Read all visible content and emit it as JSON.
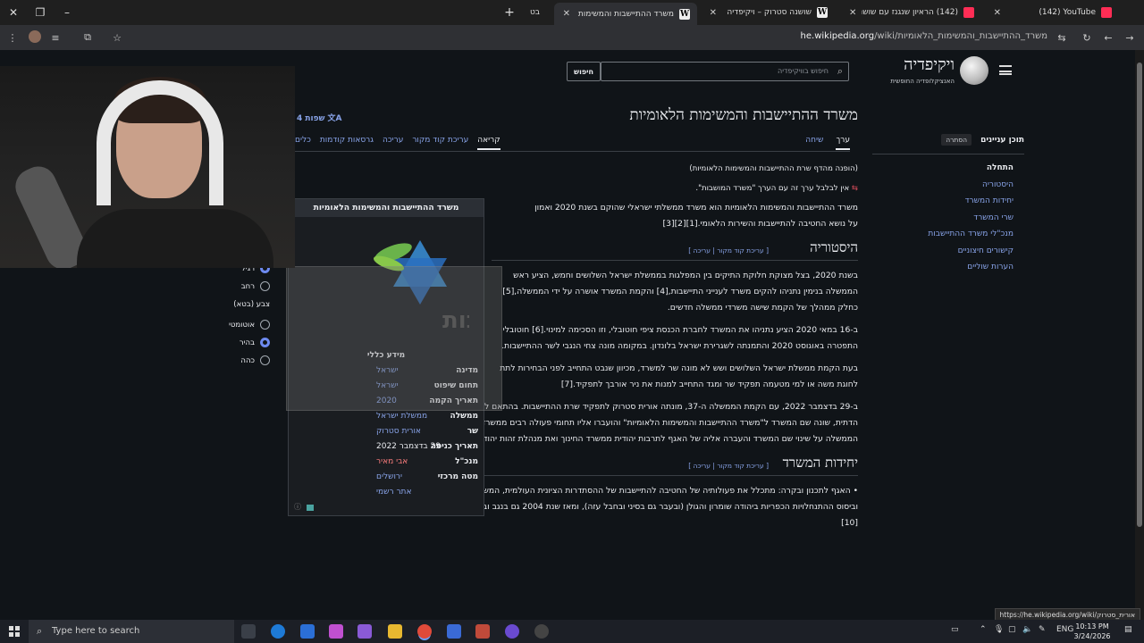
{
  "browser": {
    "tabs": [
      {
        "title": "(142) YouTube",
        "icon": "youtube-icon"
      },
      {
        "title": "(142) הראיון שנגנז עם שושנה ס",
        "icon": "youtube-icon"
      },
      {
        "title": "שושנה סטרוק – ויקיפדיה",
        "icon": "wikipedia-icon"
      },
      {
        "title": "משרד ההתיישבות והמשימות ה",
        "icon": "wikipedia-icon",
        "active": true
      },
      {
        "title": "בט",
        "icon": "page-icon"
      }
    ],
    "url_host": "he.wikipedia.org",
    "url_path": "/wiki/משרד_ההתיישבות_והמשימות_הלאומיות",
    "status_url": "https://he.wikipedia.org/wiki/אורית_סטרוק"
  },
  "wiki": {
    "logo_name": "ויקיפדיה",
    "logo_sub": "האנציקלופדיה החופשית",
    "search_placeholder": "חיפוש בוויקיפדיה",
    "search_button": "חיפוש",
    "toc_title": "תוכן עניינים",
    "toc_hide": "הסתרה",
    "toc_items": [
      "התחלה",
      "היסטוריה",
      "יחידות המשרד",
      "שרי המשרד",
      "מנכ\"לי משרד ההתיישבות",
      "קישורים חיצוניים",
      "הערות שוליים"
    ],
    "title": "משרד ההתיישבות והמשימות הלאומיות",
    "languages": "4 שפות",
    "tabs_right": [
      "ערך",
      "שיחה"
    ],
    "tabs_left": [
      "קריאה",
      "עריכת קוד מקור",
      "עריכה",
      "גרסאות קודמות",
      "כלים"
    ],
    "redirect_note": "(הופנה מהדף שרת ההתיישבות והמשימות הלאומיות)",
    "hatnote": "אין לבלבל ערך זה עם הערך \"משרד המושבות\".",
    "intro_line1": "משרד ההתיישבות והמשימות הלאומיות הוא משרד ממשלתי ישראלי שהוקם בשנת 2020 ואמון",
    "intro_line2": "על נושא החטיבה להתיישבות והשירות הלאומי.[1][2][3]",
    "section_history": "היסטוריה",
    "section_edit": "[ עריכת קוד מקור | עריכה ]",
    "p1": "בשנת 2020, בצל מצוקת חלוקת התיקים בין המפלגות בממשלת ישראל השלושים וחמש, הציע ראש הממשלה בנימין נתניהו להקים משרד לענייני התיישבות,[4] והקמת המשרד אושרה על ידי הממשלה,[5] כחלק ממהלך של הקמת שישה משרדי ממשלה חדשים.",
    "p2": "ב-16 במאי 2020 הציע נתניהו את המשרד לחברת הכנסת ציפי חוטובלי, וזו הסכימה למינוי.[6] חוטובלי התפטרה באוגוסט 2020 והתמנתה לשגרירת ישראל בלונדון. במקומה מונה צחי הנגבי לשר ההתיישבות.",
    "p3": "בעת הקמת ממשלת ישראל השלושים ושש לא מונה שר למשרד, מכיוון שנבט התחייב לפני הבחירות לתת לחוגת משה או למי מטעמה תפקיד שר ומגד התחייב למנות את ניר אורבך לתפקיד.[7]",
    "p4": "ב-29 בדצמבר 2022, עם הקמת הממשלה ה-37, מונתה אורית סטרוק לתפקיד שרת ההתיישבות. בהתאם להסכם הקואליציוני שנחתם בין סיעות הליכוד והציונות הדתית, שונה שם המשרד ל\"משרד ההתיישבות והמשימות הלאומיות\" והועברו אליו תחומי פעולה רבים ממשרדים אחרים.[8] ב-19 בפברואר 2023 החליטה הממשלה על שינוי שם המשרד והעברה אליה של האגף לתרבות יהודית ממשרד החינוך ואת מנהלת זהות יהודית מהמשרד לשירותי דת.[9]",
    "section_units": "יחידות המשרד",
    "p5": "האגף לתכנון ובקרה: מתכלל את פעולותיה של החטיבה להתיישבות של ההסתדרות הציונית העולמית, המשמשת כזרוע המבצעת של ממשלת ישראל בהקמת וביסוס ההתנחלויות הכפריות ביהודה שומרון והגולן (ובעבר גם בסיני ובחבל עזה), ומאז שנת 2004 גם בנגב ובגליל. עד 2020 היה האגף אגף במשרד החקלאות.[10]",
    "infobox": {
      "title": "משרד ההתיישבות והמשימות הלאומיות",
      "logo_text": "משרד ההתיישבות",
      "general": "מידע כללי",
      "rows": [
        {
          "label": "מדינה",
          "value": "ישראל",
          "style": "link"
        },
        {
          "label": "תחום שיפוט",
          "value": "ישראל",
          "style": "link"
        },
        {
          "label": "תאריך הקמה",
          "value": "2020",
          "style": "link"
        },
        {
          "label": "ממשלה",
          "value": "ממשלת ישראל",
          "style": "link"
        },
        {
          "label": "שר",
          "value": "אורית סטרוק",
          "style": "link"
        },
        {
          "label": "תאריך כניסה",
          "value": "29 בדצמבר 2022",
          "style": "plain"
        },
        {
          "label": "מנכ\"ל",
          "value": "אבי מאיר",
          "style": "red"
        },
        {
          "label": "מטה מרכזי",
          "value": "ירושלים",
          "style": "link"
        },
        {
          "label": "",
          "value": "אתר רשמי",
          "style": "link"
        }
      ]
    },
    "appearance": {
      "width_options": [
        {
          "label": "רגיל",
          "selected": true
        },
        {
          "label": "רחב",
          "selected": false
        }
      ],
      "color_title": "צבע (בטא)",
      "color_options": [
        {
          "label": "אוטומטי",
          "selected": false
        },
        {
          "label": "בהיר",
          "selected": true
        },
        {
          "label": "כהה",
          "selected": false
        }
      ]
    }
  },
  "taskbar": {
    "search_placeholder": "Type here to search",
    "lang": "ENG",
    "time": "10:13 PM",
    "date": "3/24/2026"
  },
  "colors": {
    "link": "#88a3e8",
    "bg": "#101418",
    "text": "#eaecf0",
    "red_link": "#f97c7c"
  }
}
